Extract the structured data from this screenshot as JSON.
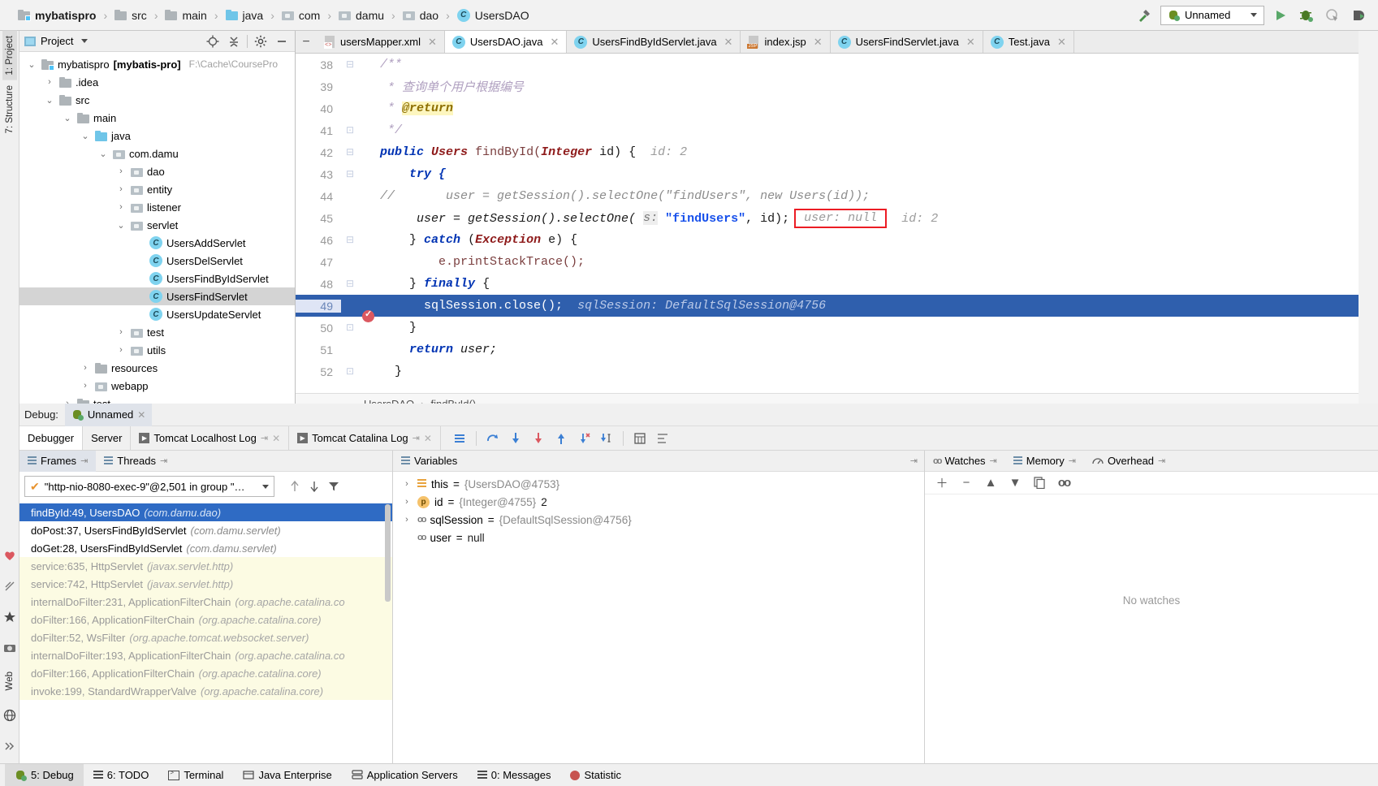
{
  "breadcrumb": {
    "items": [
      {
        "label": "mybatispro",
        "icon": "module-folder-icon",
        "bold": true
      },
      {
        "label": "src",
        "icon": "folder-icon"
      },
      {
        "label": "main",
        "icon": "folder-icon"
      },
      {
        "label": "java",
        "icon": "source-folder-icon"
      },
      {
        "label": "com",
        "icon": "package-icon"
      },
      {
        "label": "damu",
        "icon": "package-icon"
      },
      {
        "label": "dao",
        "icon": "package-icon"
      },
      {
        "label": "UsersDAO",
        "icon": "class-icon"
      }
    ]
  },
  "toolbar": {
    "run_config": "Unnamed",
    "run_icon": "run-icon",
    "debug_icon": "debug-icon",
    "coverage_icon": "run-with-coverage-icon",
    "profile_icon": "profile-icon",
    "hammer_icon": "build-icon"
  },
  "left_strip": {
    "top_tabs": [
      {
        "label": "1: Project",
        "selected": true
      },
      {
        "label": "7: Structure",
        "selected": false
      }
    ],
    "bottom_tabs": [
      {
        "label": "2: Favorites"
      },
      {
        "label": "Web"
      }
    ]
  },
  "project_panel": {
    "title": "Project",
    "actions": [
      "locate-icon",
      "collapse-all-icon",
      "gear-icon",
      "hide-icon"
    ],
    "tree": [
      {
        "depth": 0,
        "arrow": "down",
        "label": "mybatispro",
        "bold_label": "[mybatis-pro]",
        "path": "F:\\Cache\\CoursePro",
        "icon": "module-folder-icon"
      },
      {
        "depth": 1,
        "arrow": "right",
        "label": ".idea",
        "icon": "folder-icon"
      },
      {
        "depth": 1,
        "arrow": "down",
        "label": "src",
        "icon": "folder-icon"
      },
      {
        "depth": 2,
        "arrow": "down",
        "label": "main",
        "icon": "folder-icon"
      },
      {
        "depth": 3,
        "arrow": "down",
        "label": "java",
        "icon": "source-folder-icon"
      },
      {
        "depth": 4,
        "arrow": "down",
        "label": "com.damu",
        "icon": "package-icon"
      },
      {
        "depth": 5,
        "arrow": "right",
        "label": "dao",
        "icon": "package-icon"
      },
      {
        "depth": 5,
        "arrow": "right",
        "label": "entity",
        "icon": "package-icon"
      },
      {
        "depth": 5,
        "arrow": "right",
        "label": "listener",
        "icon": "package-icon"
      },
      {
        "depth": 5,
        "arrow": "down",
        "label": "servlet",
        "icon": "package-icon"
      },
      {
        "depth": 6,
        "arrow": "none",
        "label": "UsersAddServlet",
        "icon": "class-icon"
      },
      {
        "depth": 6,
        "arrow": "none",
        "label": "UsersDelServlet",
        "icon": "class-icon"
      },
      {
        "depth": 6,
        "arrow": "none",
        "label": "UsersFindByIdServlet",
        "icon": "class-icon"
      },
      {
        "depth": 6,
        "arrow": "none",
        "label": "UsersFindServlet",
        "icon": "class-icon",
        "selected": true
      },
      {
        "depth": 6,
        "arrow": "none",
        "label": "UsersUpdateServlet",
        "icon": "class-icon"
      },
      {
        "depth": 5,
        "arrow": "right",
        "label": "test",
        "icon": "package-icon"
      },
      {
        "depth": 5,
        "arrow": "right",
        "label": "utils",
        "icon": "package-icon"
      },
      {
        "depth": 4,
        "arrow": "right",
        "label": "resources",
        "icon": "resources-folder-icon"
      },
      {
        "depth": 4,
        "arrow": "right",
        "label": "webapp",
        "icon": "webapp-folder-icon"
      },
      {
        "depth": 3,
        "arrow": "right",
        "label": "test",
        "icon": "folder-icon"
      }
    ]
  },
  "editor": {
    "tabs": [
      {
        "label": "usersMapper.xml",
        "icon": "xml-file-icon",
        "active": false
      },
      {
        "label": "UsersDAO.java",
        "icon": "class-icon",
        "active": true
      },
      {
        "label": "UsersFindByIdServlet.java",
        "icon": "class-icon",
        "active": false
      },
      {
        "label": "index.jsp",
        "icon": "jsp-file-icon",
        "active": false
      },
      {
        "label": "UsersFindServlet.java",
        "icon": "class-icon",
        "active": false
      },
      {
        "label": "Test.java",
        "icon": "class-icon",
        "active": false
      }
    ],
    "lines": [
      {
        "num": "38",
        "fold": "minus"
      },
      {
        "num": "39",
        "fold": ""
      },
      {
        "num": "40",
        "fold": ""
      },
      {
        "num": "41",
        "fold": "end"
      },
      {
        "num": "42",
        "fold": "minus"
      },
      {
        "num": "43",
        "fold": "minus"
      },
      {
        "num": "44",
        "fold": ""
      },
      {
        "num": "45",
        "fold": ""
      },
      {
        "num": "46",
        "fold": "minus"
      },
      {
        "num": "47",
        "fold": ""
      },
      {
        "num": "48",
        "fold": "minus"
      },
      {
        "num": "49",
        "fold": "",
        "highlighted": true,
        "breakpoint": true
      },
      {
        "num": "50",
        "fold": "end"
      },
      {
        "num": "51",
        "fold": ""
      },
      {
        "num": "52",
        "fold": "end"
      }
    ],
    "code": {
      "l38": "/**",
      "l39_star": "*",
      "l39_text": "查询单个用户根据编号",
      "l40_star": "*",
      "l40_tag": "@return",
      "l41": "*/",
      "l42_public": "public",
      "l42_users": "Users",
      "l42_method": "findById(",
      "l42_integer": "Integer",
      "l42_id": "id) {",
      "l42_hint": "id: 2",
      "l43": "try {",
      "l44_slash": "//",
      "l44_comment": "user = getSession().selectOne(\"findUsers\", new Users(id));",
      "l45_a": "user = getSession().selectOne(",
      "l45_param": "s:",
      "l45_str": "\"findUsers\"",
      "l45_b": ", id);",
      "l45_hint_boxed": "user: null",
      "l45_hint2": "id: 2",
      "l46": "} catch (Exception e) {",
      "l46_catch": "catch",
      "l46_exc": "Exception",
      "l47": "e.printStackTrace();",
      "l48": "} finally {",
      "l48_finally": "finally",
      "l49_code": "sqlSession.close();",
      "l49_hint": "sqlSession: DefaultSqlSession@4756",
      "l50": "}",
      "l51_return": "return",
      "l51_user": "user;",
      "l52": "}"
    },
    "status": {
      "class": "UsersDAO",
      "sep": "›",
      "method": "findById()"
    }
  },
  "debug": {
    "title_label": "Debug:",
    "session_tab": "Unnamed",
    "tabs": [
      {
        "label": "Debugger",
        "active": true
      },
      {
        "label": "Server",
        "active": false
      },
      {
        "label": "Tomcat Localhost Log",
        "active": false,
        "closeable": true
      },
      {
        "label": "Tomcat Catalina Log",
        "active": false,
        "closeable": true
      }
    ],
    "actions": [
      "mute-breakpoints-icon",
      "step-over-icon",
      "step-into-icon",
      "force-step-into-icon",
      "step-out-icon",
      "drop-frame-icon",
      "run-to-cursor-icon",
      "evaluate-expression-icon",
      "settings-icon"
    ],
    "frames": {
      "tabs": [
        {
          "label": "Frames",
          "active": true
        },
        {
          "label": "Threads",
          "active": false
        }
      ],
      "thread": "\"http-nio-8080-exec-9\"@2,501 in group \"…",
      "thread_actions": [
        "up-arrow-icon",
        "down-arrow-icon",
        "filter-icon"
      ],
      "rows": [
        {
          "label": "findById:49, UsersDAO",
          "pkg": "(com.damu.dao)",
          "selected": true
        },
        {
          "label": "doPost:37, UsersFindByIdServlet",
          "pkg": "(com.damu.servlet)"
        },
        {
          "label": "doGet:28, UsersFindByIdServlet",
          "pkg": "(com.damu.servlet)"
        },
        {
          "label": "service:635, HttpServlet",
          "pkg": "(javax.servlet.http)",
          "lib": true
        },
        {
          "label": "service:742, HttpServlet",
          "pkg": "(javax.servlet.http)",
          "lib": true
        },
        {
          "label": "internalDoFilter:231, ApplicationFilterChain",
          "pkg": "(org.apache.catalina.co",
          "lib": true
        },
        {
          "label": "doFilter:166, ApplicationFilterChain",
          "pkg": "(org.apache.catalina.core)",
          "lib": true
        },
        {
          "label": "doFilter:52, WsFilter",
          "pkg": "(org.apache.tomcat.websocket.server)",
          "lib": true
        },
        {
          "label": "internalDoFilter:193, ApplicationFilterChain",
          "pkg": "(org.apache.catalina.co",
          "lib": true
        },
        {
          "label": "doFilter:166, ApplicationFilterChain",
          "pkg": "(org.apache.catalina.core)",
          "lib": true
        },
        {
          "label": "invoke:199, StandardWrapperValve",
          "pkg": "(org.apache.catalina.core)",
          "lib": true
        }
      ]
    },
    "variables": {
      "title": "Variables",
      "rows": [
        {
          "twisty": "right",
          "icon": "object-icon",
          "name": "this",
          "eq": "=",
          "value": "{UsersDAO@4753}",
          "extra": ""
        },
        {
          "twisty": "right",
          "icon": "param-icon",
          "name": "id",
          "eq": "=",
          "value": "{Integer@4755}",
          "extra": "2"
        },
        {
          "twisty": "right",
          "icon": "field-icon",
          "name": "sqlSession",
          "eq": "=",
          "value": "{DefaultSqlSession@4756}",
          "extra": ""
        },
        {
          "twisty": "none",
          "icon": "field-icon",
          "name": "user",
          "eq": "=",
          "value": "null",
          "extra": ""
        }
      ]
    },
    "watches": {
      "tabs": [
        {
          "label": "Watches",
          "active": false
        },
        {
          "label": "Memory",
          "active": false
        },
        {
          "label": "Overhead",
          "active": false
        }
      ],
      "actions": [
        "add-watch-icon",
        "remove-watch-icon",
        "move-up-icon",
        "move-down-icon",
        "copy-icon",
        "link-icon"
      ],
      "empty_text": "No watches"
    }
  },
  "statusbar": {
    "items": [
      {
        "label": "5: Debug",
        "icon": "debug-icon",
        "active": true
      },
      {
        "label": "6: TODO",
        "icon": "todo-icon"
      },
      {
        "label": "Terminal",
        "icon": "terminal-icon"
      },
      {
        "label": "Java Enterprise",
        "icon": "java-enterprise-icon"
      },
      {
        "label": "Application Servers",
        "icon": "app-servers-icon"
      },
      {
        "label": "0: Messages",
        "icon": "messages-icon"
      },
      {
        "label": "Statistic",
        "icon": "statistic-icon"
      }
    ]
  },
  "colors": {
    "accent_blue": "#2f6bc4",
    "selection_blue": "#2f5fad",
    "red_box": "#ec1c24",
    "lib_frame_bg": "#fcfbe3",
    "breakpoint_red": "#db5860"
  }
}
